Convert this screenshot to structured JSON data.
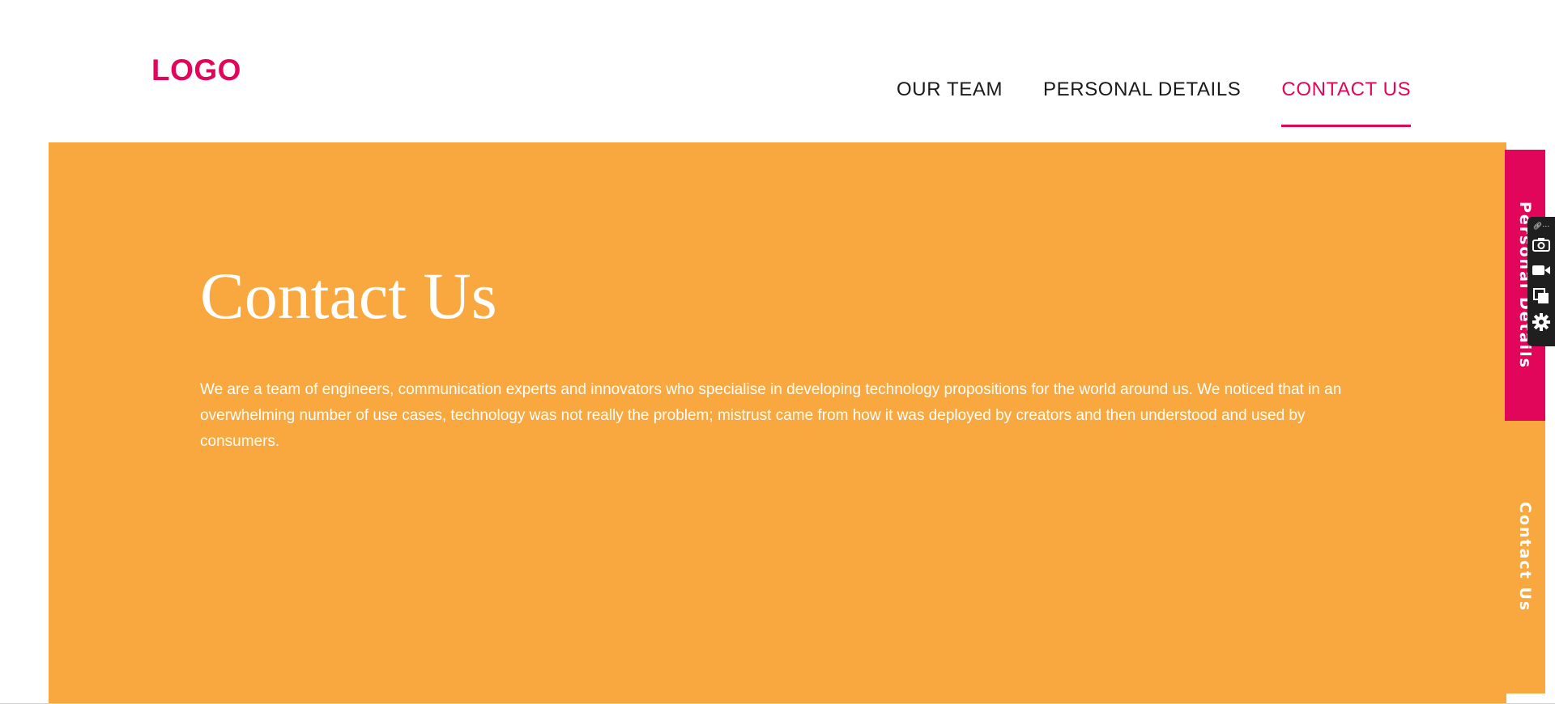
{
  "header": {
    "logo": "LOGO",
    "nav": [
      {
        "label": "OUR TEAM",
        "active": false
      },
      {
        "label": "PERSONAL DETAILS",
        "active": false
      },
      {
        "label": "CONTACT US",
        "active": true
      }
    ]
  },
  "hero": {
    "title": "Contact Us",
    "body": "We are a team of engineers, communication experts and innovators who specialise in developing technology propositions for the world around us. We noticed that in an overwhelming number of use cases, technology was not really the problem; mistrust came from how it was deployed by creators and then understood and used by consumers."
  },
  "side_tabs": {
    "personal": "Personal Details",
    "contact": "Contact Us"
  },
  "toolbar": {
    "icons": [
      "link-icon",
      "more-icon",
      "camera-icon",
      "video-icon",
      "copy-icon",
      "gear-icon"
    ]
  },
  "colors": {
    "brand_pink": "#e2065b",
    "hero_orange": "#f9a73f",
    "white": "#ffffff",
    "toolbar_dark": "#1f1f1f"
  }
}
